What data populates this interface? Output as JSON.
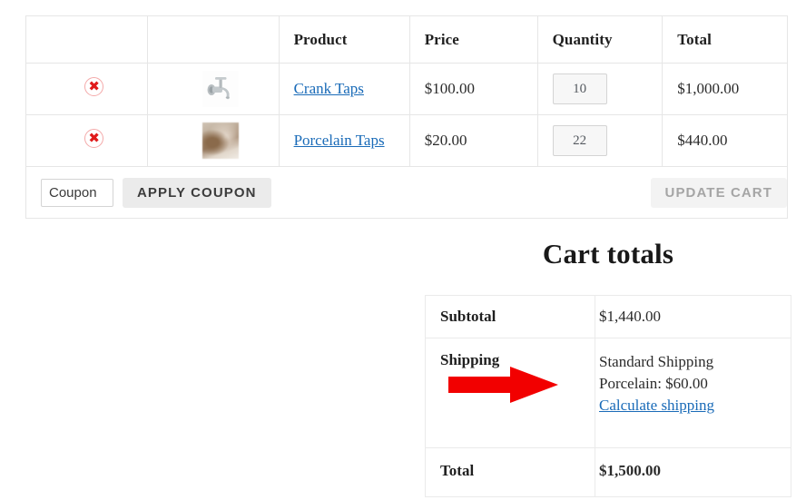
{
  "cart_table": {
    "columns": [
      "",
      "",
      "Product",
      "Price",
      "Quantity",
      "Total"
    ],
    "headers": {
      "remove": "",
      "thumbnail": "",
      "product": "Product",
      "price": "Price",
      "quantity": "Quantity",
      "total": "Total"
    },
    "rows": [
      {
        "remove_icon": "remove-circle-x-icon",
        "thumbnail_icon": "faucet-tap-thumbnail",
        "product": "Crank Taps",
        "price": "$100.00",
        "quantity": "10",
        "total": "$1,000.00"
      },
      {
        "remove_icon": "remove-circle-x-icon",
        "thumbnail_icon": "porcelain-tap-thumbnail",
        "product": "Porcelain Taps",
        "price": "$20.00",
        "quantity": "22",
        "total": "$440.00"
      }
    ],
    "actions": {
      "coupon_placeholder": "Coupon",
      "coupon_value": "",
      "apply_coupon_label": "APPLY COUPON",
      "update_cart_label": "UPDATE CART"
    }
  },
  "cart_totals": {
    "title": "Cart totals",
    "subtotal_label": "Subtotal",
    "subtotal_value": "$1,440.00",
    "shipping_label": "Shipping",
    "shipping_method": "Standard Shipping",
    "shipping_detail": "Porcelain: $60.00",
    "calculate_shipping_label": "Calculate shipping",
    "total_label": "Total",
    "total_value": "$1,500.00"
  },
  "annotation": {
    "arrow_icon": "red-arrow-right-icon",
    "arrow_color": "#f20000"
  },
  "colors": {
    "link": "#1a6bb8",
    "remove_x": "#e01b1b",
    "text": "#2b2b2b",
    "border": "#e6e6e6",
    "button_bg": "#ebebeb",
    "disabled_text": "#a5a5a5"
  }
}
